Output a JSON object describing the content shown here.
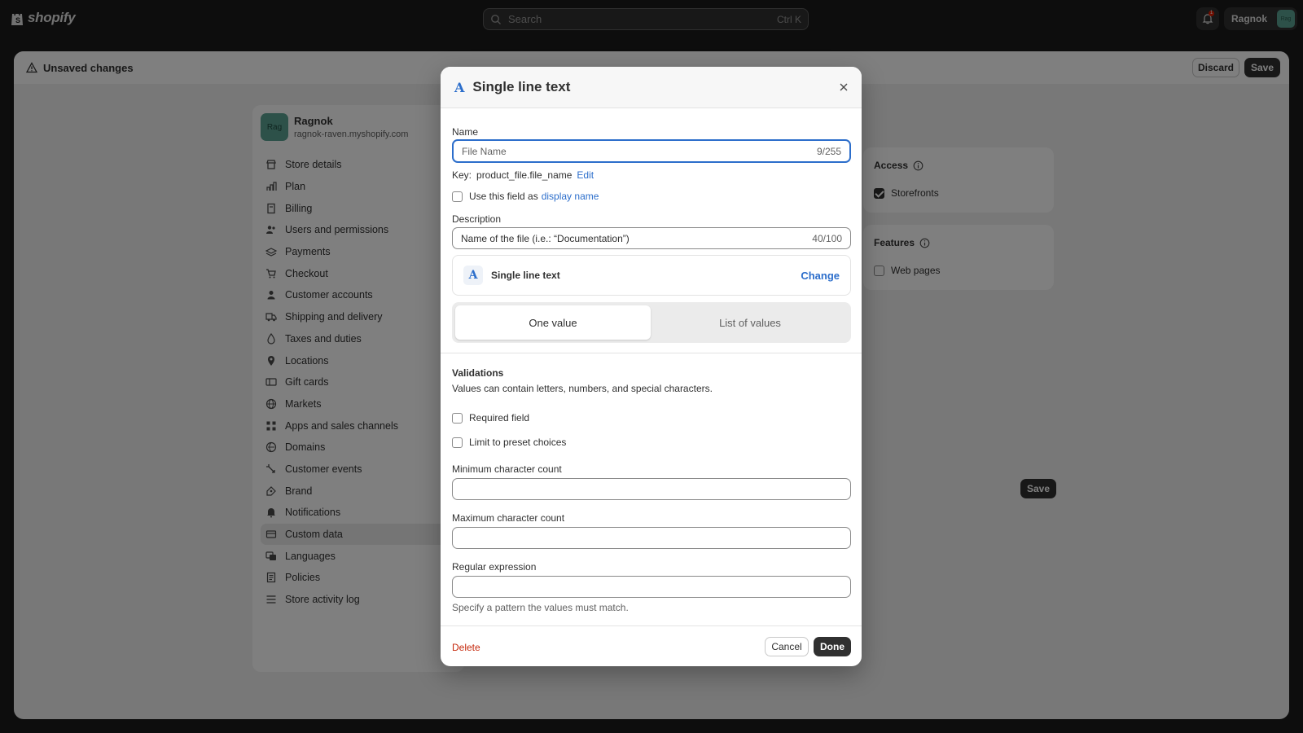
{
  "topbar": {
    "logo_text": "shopify",
    "search_placeholder": "Search",
    "search_shortcut": "Ctrl K",
    "notification_count": "1",
    "user_name": "Ragnok",
    "user_avatar": "Rag"
  },
  "unsaved_bar": {
    "text": "Unsaved changes",
    "discard_label": "Discard",
    "save_label": "Save"
  },
  "store": {
    "avatar": "Rag",
    "name": "Ragnok",
    "domain": "ragnok-raven.myshopify.com"
  },
  "nav": {
    "items": [
      {
        "label": "Store details",
        "icon": "store-icon"
      },
      {
        "label": "Plan",
        "icon": "plan-icon"
      },
      {
        "label": "Billing",
        "icon": "billing-icon"
      },
      {
        "label": "Users and permissions",
        "icon": "users-icon"
      },
      {
        "label": "Payments",
        "icon": "payments-icon"
      },
      {
        "label": "Checkout",
        "icon": "cart-icon"
      },
      {
        "label": "Customer accounts",
        "icon": "person-icon"
      },
      {
        "label": "Shipping and delivery",
        "icon": "truck-icon"
      },
      {
        "label": "Taxes and duties",
        "icon": "taxes-icon"
      },
      {
        "label": "Locations",
        "icon": "location-icon"
      },
      {
        "label": "Gift cards",
        "icon": "gift-card-icon"
      },
      {
        "label": "Markets",
        "icon": "globe-icon"
      },
      {
        "label": "Apps and sales channels",
        "icon": "apps-icon"
      },
      {
        "label": "Domains",
        "icon": "domain-icon"
      },
      {
        "label": "Customer events",
        "icon": "events-icon"
      },
      {
        "label": "Brand",
        "icon": "brand-icon"
      },
      {
        "label": "Notifications",
        "icon": "bell-icon"
      },
      {
        "label": "Custom data",
        "icon": "custom-data-icon"
      },
      {
        "label": "Languages",
        "icon": "languages-icon"
      },
      {
        "label": "Policies",
        "icon": "policies-icon"
      },
      {
        "label": "Store activity log",
        "icon": "list-icon"
      }
    ],
    "active_index": 17
  },
  "access": {
    "title": "Access",
    "storefronts_label": "Storefronts",
    "storefronts_checked": true
  },
  "features": {
    "title": "Features",
    "web_pages_label": "Web pages",
    "web_pages_checked": false
  },
  "page_save_label": "Save",
  "modal": {
    "title": "Single line text",
    "name_label": "Name",
    "name_value": "File Name",
    "name_count": "9/255",
    "key_label": "Key:",
    "key_value": "product_file.file_name",
    "key_edit": "Edit",
    "display_name_text": "Use this field as",
    "display_name_link": "display name",
    "description_label": "Description",
    "description_value": "Name of the file (i.e.: “Documentation”)",
    "description_count": "40/100",
    "type_name": "Single line text",
    "type_change": "Change",
    "one_value": "One value",
    "list_of_values": "List of values",
    "validations_title": "Validations",
    "validations_desc": "Values can contain letters, numbers, and special characters.",
    "required_field": "Required field",
    "limit_choices": "Limit to preset choices",
    "min_label": "Minimum character count",
    "max_label": "Maximum character count",
    "regex_label": "Regular expression",
    "regex_help": "Specify a pattern the values must match.",
    "delete_label": "Delete",
    "cancel_label": "Cancel",
    "done_label": "Done"
  },
  "colors": {
    "accent": "#2c6ecb",
    "danger": "#c5280c",
    "primary_button": "#303030",
    "store_avatar": "#5aa292"
  }
}
